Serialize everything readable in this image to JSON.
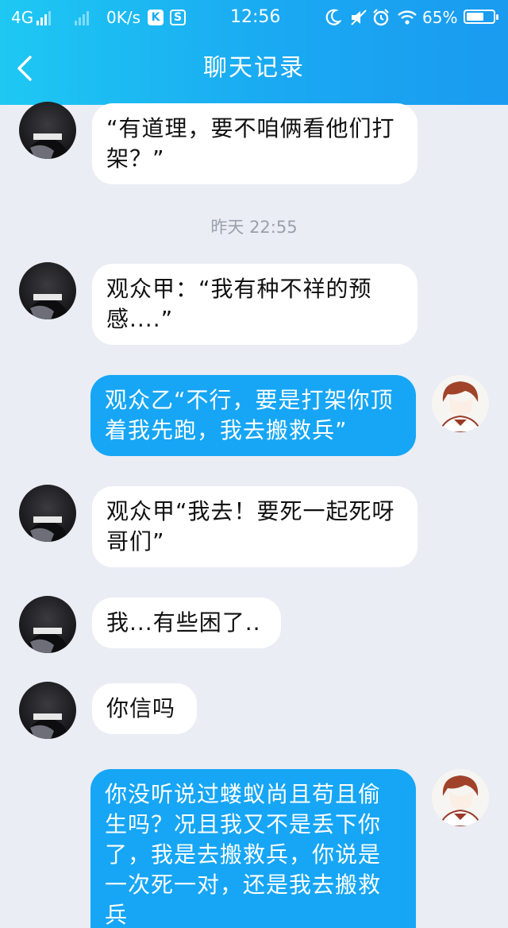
{
  "status_bar": {
    "network": "4G",
    "speed": "0K/s",
    "time": "12:56",
    "battery": "65%",
    "battery_level": 0.65
  },
  "header": {
    "title": "聊天记录"
  },
  "timestamp": "昨天 22:55",
  "messages": [
    {
      "side": "left",
      "text": "“有道理，要不咱俩看他们打架？”"
    },
    {
      "side": "left",
      "text": "观众甲：“我有种不祥的预感....”"
    },
    {
      "side": "right",
      "text": "观众乙“不行，要是打架你顶着我先跑，我去搬救兵”"
    },
    {
      "side": "left",
      "text": "观众甲“我去！要死一起死呀哥们”"
    },
    {
      "side": "left",
      "text": "我...有些困了.."
    },
    {
      "side": "left",
      "text": "你信吗"
    },
    {
      "side": "right",
      "text": "你没听说过蝼蚁尚且苟且偷生吗？况且我又不是丢下你了，我是去搬救兵，你说是一次死一对，还是我去搬救兵"
    }
  ],
  "colors": {
    "header_start": "#1ec8f3",
    "header_end": "#1a9bf0",
    "background": "#eaedf4",
    "bubble_right": "#16a6f5",
    "bubble_left": "#ffffff"
  },
  "icons": {
    "back": "chevron-left-icon",
    "moon": "moon-icon",
    "mute": "mute-icon",
    "alarm": "alarm-icon",
    "wifi": "wifi-icon"
  }
}
